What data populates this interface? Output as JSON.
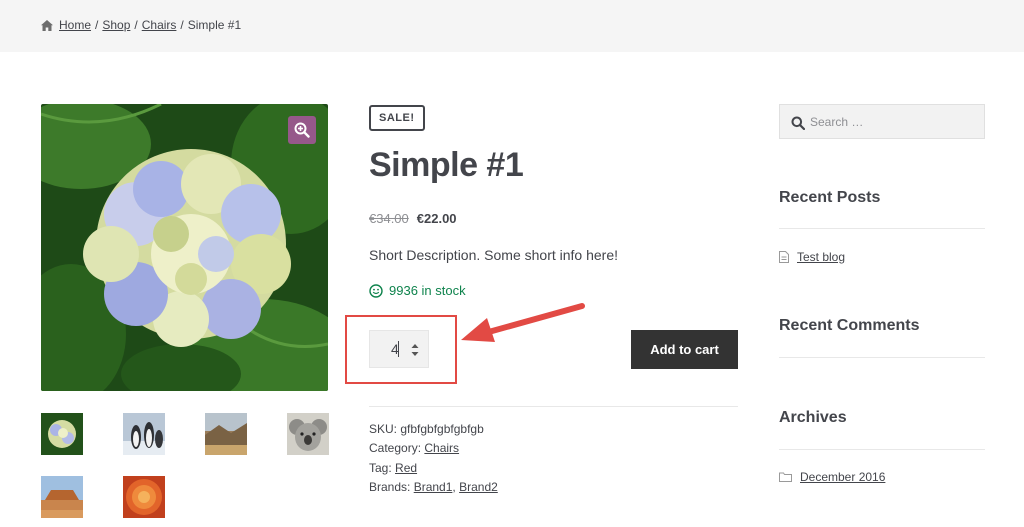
{
  "breadcrumb": {
    "home": "Home",
    "shop": "Shop",
    "category": "Chairs",
    "current": "Simple #1",
    "separator": "/"
  },
  "product": {
    "sale_badge": "SALE!",
    "title": "Simple #1",
    "old_price": "€34.00",
    "new_price": "€22.00",
    "short_description": "Short Description. Some short info here!",
    "stock": "9936 in stock",
    "quantity": "4",
    "add_to_cart_label": "Add to cart",
    "thumbnail_icons": [
      "hydrangea-thumbnail",
      "penguins-thumbnail",
      "landscape-thumbnail",
      "koala-thumbnail",
      "desert-thumbnail",
      "chrysanthemum-thumbnail"
    ]
  },
  "meta": {
    "sku_label": "SKU:",
    "sku_value": "gfbfgbfgbfgbfgb",
    "category_label": "Category:",
    "category_value": "Chairs",
    "tag_label": "Tag:",
    "tag_value": "Red",
    "brands_label": "Brands:",
    "brand1": "Brand1",
    "brand_separator": ",",
    "brand2": "Brand2"
  },
  "sidebar": {
    "search_placeholder": "Search …",
    "recent_posts_title": "Recent Posts",
    "recent_post_1": "Test blog",
    "recent_comments_title": "Recent Comments",
    "archives_title": "Archives",
    "archive_1": "December 2016"
  },
  "colors": {
    "accent_purple": "#96588a",
    "stock_green": "#0f834d",
    "highlight_red": "#e24a44",
    "button_dark": "#333333"
  }
}
